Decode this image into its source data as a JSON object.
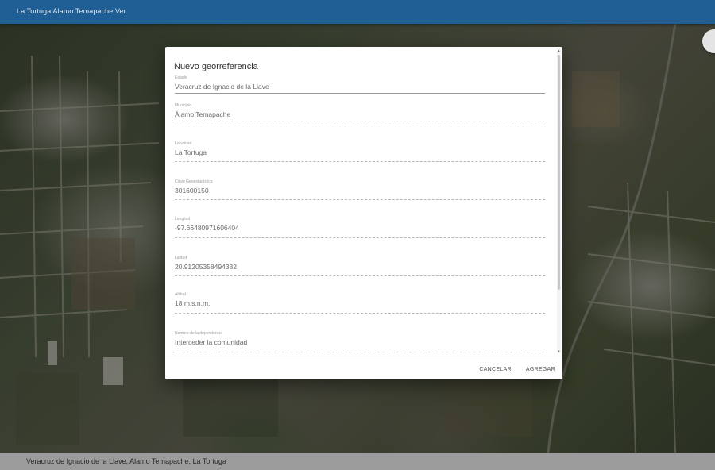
{
  "appbar": {
    "title": "La Tortuga Alamo Temapache Ver."
  },
  "statusbar": {
    "text": "Veracruz de Ignacio de la Llave, Alamo Temapache, La Tortuga"
  },
  "dialog": {
    "title": "Nuevo georreferencia",
    "fields": [
      {
        "label": "Estado",
        "value": "Veracruz de Ignacio de la Llave"
      },
      {
        "label": "Municipio",
        "value": "Álamo Temapache"
      },
      {
        "label": "Localidad",
        "value": "La Tortuga"
      },
      {
        "label": "Clave Geoestadística",
        "value": "301600150"
      },
      {
        "label": "Longitud",
        "value": "-97.66480971606404"
      },
      {
        "label": "Latitud",
        "value": "20.91205358494332"
      },
      {
        "label": "Altitud",
        "value": "18 m.s.n.m."
      },
      {
        "label": "Nombre de la dependencia",
        "value": "Interceder la comunidad"
      }
    ],
    "actions": {
      "cancel": "CANCELAR",
      "add": "AGREGAR"
    }
  },
  "colors": {
    "appbar": "#1f5f96",
    "statusbar": "#9c9c9c",
    "dialog": "#ffffff"
  }
}
